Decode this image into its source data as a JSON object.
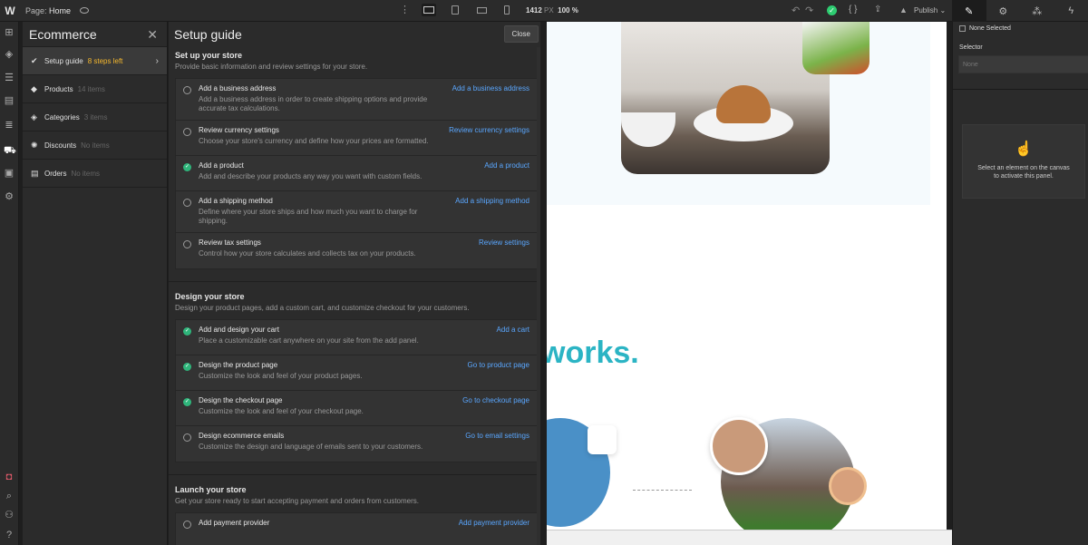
{
  "topbar": {
    "logo": "W",
    "page_prefix": "Page:",
    "page_name": "Home",
    "width_value": "1412",
    "width_unit": "PX",
    "zoom": "100 %",
    "publish_label": "Publish"
  },
  "ecommerce": {
    "title": "Ecommerce",
    "items": [
      {
        "label": "Setup guide",
        "sub": "8 steps left",
        "icon": "check-circle-icon"
      },
      {
        "label": "Products",
        "sub": "14 items",
        "icon": "tag-icon"
      },
      {
        "label": "Categories",
        "sub": "3 items",
        "icon": "box-icon"
      },
      {
        "label": "Discounts",
        "sub": "No items",
        "icon": "gear-icon"
      },
      {
        "label": "Orders",
        "sub": "No items",
        "icon": "document-icon"
      }
    ]
  },
  "guide": {
    "title": "Setup guide",
    "close_label": "Close",
    "sections": [
      {
        "title": "Set up your store",
        "desc": "Provide basic information and review settings for your store.",
        "tasks": [
          {
            "title": "Add a business address",
            "desc": "Add a business address in order to create shipping options and provide accurate tax calculations.",
            "link": "Add a business address",
            "done": false
          },
          {
            "title": "Review currency settings",
            "desc": "Choose your store's currency and define how your prices are formatted.",
            "link": "Review currency settings",
            "done": false
          },
          {
            "title": "Add a product",
            "desc": "Add and describe your products any way you want with custom fields.",
            "link": "Add a product",
            "done": true
          },
          {
            "title": "Add a shipping method",
            "desc": "Define where your store ships and how much you want to charge for shipping.",
            "link": "Add a shipping method",
            "done": false
          },
          {
            "title": "Review tax settings",
            "desc": "Control how your store calculates and collects tax on your products.",
            "link": "Review settings",
            "done": false
          }
        ]
      },
      {
        "title": "Design your store",
        "desc": "Design your product pages, add a custom cart, and customize checkout for your customers.",
        "tasks": [
          {
            "title": "Add and design your cart",
            "desc": "Place a customizable cart anywhere on your site from the add panel.",
            "link": "Add a cart",
            "done": true
          },
          {
            "title": "Design the product page",
            "desc": "Customize the look and feel of your product pages.",
            "link": "Go to product page",
            "done": true
          },
          {
            "title": "Design the checkout page",
            "desc": "Customize the look and feel of your checkout page.",
            "link": "Go to checkout page",
            "done": true
          },
          {
            "title": "Design ecommerce emails",
            "desc": "Customize the design and language of emails sent to your customers.",
            "link": "Go to email settings",
            "done": false
          }
        ]
      },
      {
        "title": "Launch your store",
        "desc": "Get your store ready to start accepting payment and orders from customers.",
        "tasks": [
          {
            "title": "Add payment provider",
            "desc": "",
            "link": "Add payment provider",
            "done": false
          }
        ]
      }
    ]
  },
  "canvas": {
    "headline": "works."
  },
  "right_panel": {
    "none_selected": "None Selected",
    "selector_label": "Selector",
    "selector_placeholder": "None",
    "empty_message_line1": "Select an element on the canvas",
    "empty_message_line2": "to activate this panel."
  },
  "colors": {
    "accent_link": "#5aa7ff",
    "done_green": "#2fb57b",
    "warn_yellow": "#f5b82e",
    "headline_teal": "#2bb4c4"
  }
}
